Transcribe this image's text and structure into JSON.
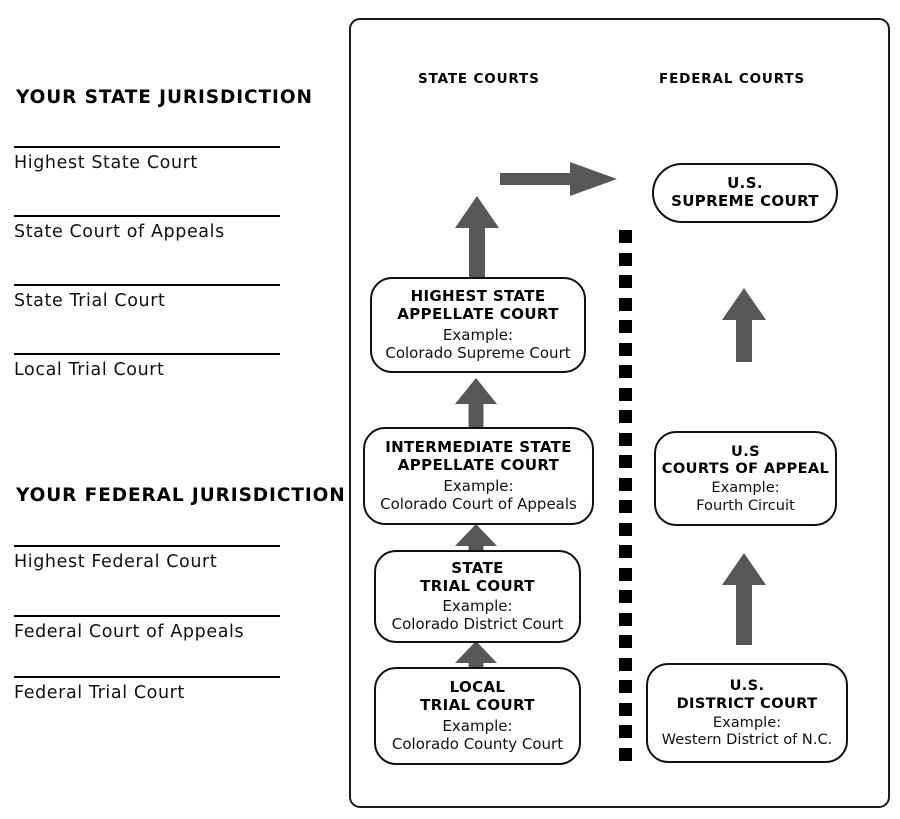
{
  "left_panel": {
    "state_section": {
      "heading": "YOUR  STATE  JURISDICTION",
      "entries": [
        {
          "label": "Highest  State  Court"
        },
        {
          "label": "State  Court  of  Appeals"
        },
        {
          "label": "State  Trial  Court"
        },
        {
          "label": "Local  Trial  Court"
        }
      ]
    },
    "federal_section": {
      "heading": "YOUR  FEDERAL JURISDICTION",
      "entries": [
        {
          "label": "Highest  Federal  Court"
        },
        {
          "label": "Federal  Court  of  Appeals"
        },
        {
          "label": "Federal  Trial  Court"
        }
      ]
    }
  },
  "diagram": {
    "columns": {
      "state": "STATE COURTS",
      "federal": "FEDERAL COURTS"
    },
    "example_label": "Example:",
    "state_courts": [
      {
        "id": "highest-state-appellate-court",
        "title_line1": "HIGHEST STATE",
        "title_line2": "APPELLATE COURT",
        "example_label": "Example:",
        "example_value": "Colorado Supreme Court"
      },
      {
        "id": "intermediate-state-appellate-court",
        "title_line1": "INTERMEDIATE STATE",
        "title_line2": "APPELLATE COURT",
        "example_label": "Example:",
        "example_value": "Colorado  Court  of  Appeals"
      },
      {
        "id": "state-trial-court",
        "title_line1": "STATE",
        "title_line2": "TRIAL COURT",
        "example_label": "Example:",
        "example_value": "Colorado District Court"
      },
      {
        "id": "local-trial-court",
        "title_line1": "LOCAL",
        "title_line2": "TRIAL COURT",
        "example_label": "Example:",
        "example_value": "Colorado County Court"
      }
    ],
    "federal_courts": [
      {
        "id": "us-supreme-court",
        "title_line1": "U.S.",
        "title_line2": "SUPREME COURT",
        "example_label": "",
        "example_value": ""
      },
      {
        "id": "us-courts-of-appeal",
        "title_line1": "U.S",
        "title_line2": "COURTS OF APPEAL",
        "example_label": "Example:",
        "example_value": "Fourth Circuit"
      },
      {
        "id": "us-district-court",
        "title_line1": "U.S.",
        "title_line2": "DISTRICT COURT",
        "example_label": "Example:",
        "example_value": "Western  District  of  N.C."
      }
    ]
  },
  "colors": {
    "arrow": "#575757",
    "outline": "#111111",
    "divider": "#000000",
    "frame": "#1b1b1b"
  }
}
